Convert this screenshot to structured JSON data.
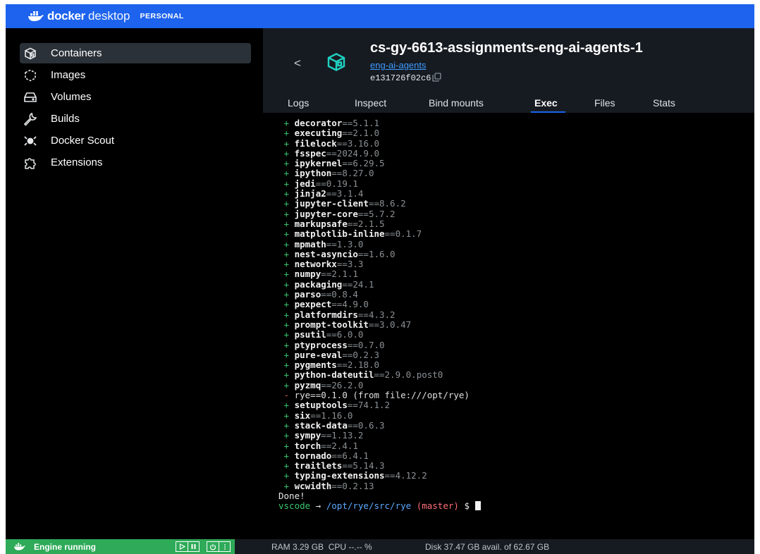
{
  "app": {
    "brand_docker": "docker",
    "brand_desktop": "desktop",
    "brand_tier": "PERSONAL",
    "accent_color": "#1d63ed"
  },
  "sidebar": {
    "items": [
      {
        "label": "Containers",
        "icon": "container-icon",
        "active": true
      },
      {
        "label": "Images",
        "icon": "images-icon",
        "active": false
      },
      {
        "label": "Volumes",
        "icon": "volume-icon",
        "active": false
      },
      {
        "label": "Builds",
        "icon": "wrench-icon",
        "active": false
      },
      {
        "label": "Docker Scout",
        "icon": "scout-icon",
        "active": false
      },
      {
        "label": "Extensions",
        "icon": "puzzle-icon",
        "active": false
      }
    ]
  },
  "container": {
    "back_label": "<",
    "name": "cs-gy-6613-assignments-eng-ai-agents-1",
    "project_link": "eng-ai-agents",
    "id": "e131726f02c6"
  },
  "tabs": [
    {
      "label": "Logs",
      "active": false
    },
    {
      "label": "Inspect",
      "active": false
    },
    {
      "label": "Bind mounts",
      "active": false
    },
    {
      "label": "Exec",
      "active": true
    },
    {
      "label": "Files",
      "active": false
    },
    {
      "label": "Stats",
      "active": false
    }
  ],
  "terminal": {
    "packages": [
      {
        "sign": "+",
        "name": "decorator",
        "version": "==5.1.1"
      },
      {
        "sign": "+",
        "name": "executing",
        "version": "==2.1.0"
      },
      {
        "sign": "+",
        "name": "filelock",
        "version": "==3.16.0"
      },
      {
        "sign": "+",
        "name": "fsspec",
        "version": "==2024.9.0"
      },
      {
        "sign": "+",
        "name": "ipykernel",
        "version": "==6.29.5"
      },
      {
        "sign": "+",
        "name": "ipython",
        "version": "==8.27.0"
      },
      {
        "sign": "+",
        "name": "jedi",
        "version": "==0.19.1"
      },
      {
        "sign": "+",
        "name": "jinja2",
        "version": "==3.1.4"
      },
      {
        "sign": "+",
        "name": "jupyter-client",
        "version": "==8.6.2"
      },
      {
        "sign": "+",
        "name": "jupyter-core",
        "version": "==5.7.2"
      },
      {
        "sign": "+",
        "name": "markupsafe",
        "version": "==2.1.5"
      },
      {
        "sign": "+",
        "name": "matplotlib-inline",
        "version": "==0.1.7"
      },
      {
        "sign": "+",
        "name": "mpmath",
        "version": "==1.3.0"
      },
      {
        "sign": "+",
        "name": "nest-asyncio",
        "version": "==1.6.0"
      },
      {
        "sign": "+",
        "name": "networkx",
        "version": "==3.3"
      },
      {
        "sign": "+",
        "name": "numpy",
        "version": "==2.1.1"
      },
      {
        "sign": "+",
        "name": "packaging",
        "version": "==24.1"
      },
      {
        "sign": "+",
        "name": "parso",
        "version": "==0.8.4"
      },
      {
        "sign": "+",
        "name": "pexpect",
        "version": "==4.9.0"
      },
      {
        "sign": "+",
        "name": "platformdirs",
        "version": "==4.3.2"
      },
      {
        "sign": "+",
        "name": "prompt-toolkit",
        "version": "==3.0.47"
      },
      {
        "sign": "+",
        "name": "psutil",
        "version": "==6.0.0"
      },
      {
        "sign": "+",
        "name": "ptyprocess",
        "version": "==0.7.0"
      },
      {
        "sign": "+",
        "name": "pure-eval",
        "version": "==0.2.3"
      },
      {
        "sign": "+",
        "name": "pygments",
        "version": "==2.18.0"
      },
      {
        "sign": "+",
        "name": "python-dateutil",
        "version": "==2.9.0.post0"
      },
      {
        "sign": "+",
        "name": "pyzmq",
        "version": "==26.2.0"
      },
      {
        "sign": "-",
        "name": "rye",
        "version": "==0.1.0 (from file:///opt/rye)"
      },
      {
        "sign": "+",
        "name": "setuptools",
        "version": "==74.1.2"
      },
      {
        "sign": "+",
        "name": "six",
        "version": "==1.16.0"
      },
      {
        "sign": "+",
        "name": "stack-data",
        "version": "==0.6.3"
      },
      {
        "sign": "+",
        "name": "sympy",
        "version": "==1.13.2"
      },
      {
        "sign": "+",
        "name": "torch",
        "version": "==2.4.1"
      },
      {
        "sign": "+",
        "name": "tornado",
        "version": "==6.4.1"
      },
      {
        "sign": "+",
        "name": "traitlets",
        "version": "==5.14.3"
      },
      {
        "sign": "+",
        "name": "typing-extensions",
        "version": "==4.12.2"
      },
      {
        "sign": "+",
        "name": "wcwidth",
        "version": "==0.2.13"
      }
    ],
    "done_text": "Done!",
    "prompt_user": "vscode",
    "prompt_arrow": "→",
    "prompt_path": "/opt/rye/src/rye",
    "prompt_branch": "(master)",
    "prompt_symbol": "$"
  },
  "status": {
    "engine_label": "Engine running",
    "engine_color": "#2eaa58",
    "ram": "RAM 3.29 GB",
    "cpu": "CPU --.-- %",
    "disk": "Disk 37.47 GB avail. of 62.67 GB"
  }
}
